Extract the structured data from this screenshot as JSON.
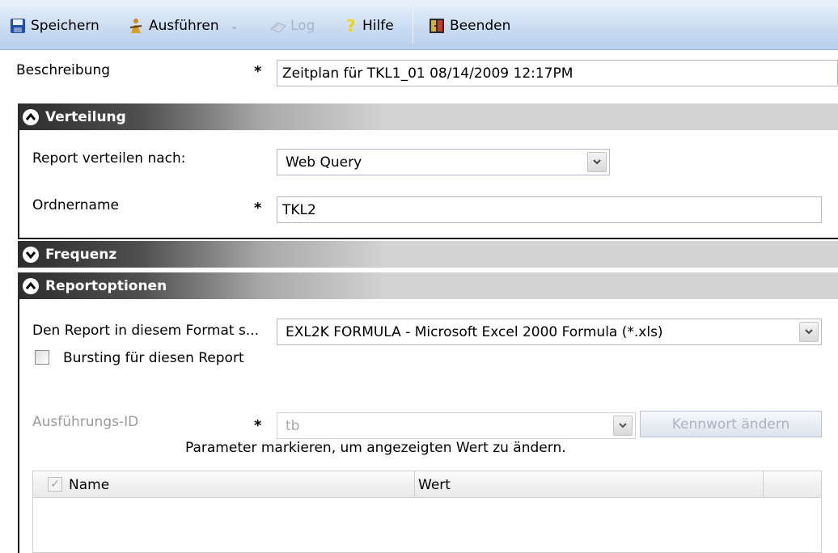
{
  "toolbar": {
    "save": "Speichern",
    "run": "Ausführen",
    "log": "Log",
    "help": "Hilfe",
    "exit": "Beenden"
  },
  "description": {
    "label": "Beschreibung",
    "required_marker": "*",
    "value": "Zeitplan für TKL1_01 08/14/2009 12:17PM"
  },
  "sections": {
    "distribution": "Verteilung",
    "frequency": "Frequenz",
    "report_options": "Reportoptionen"
  },
  "distribution": {
    "distribute_label": "Report verteilen nach:",
    "distribute_value": "Web Query",
    "folder_label": "Ordnername",
    "folder_required": "*",
    "folder_value": "TKL2"
  },
  "report_options": {
    "format_label": "Den Report in diesem Format s...",
    "format_value": "EXL2K FORMULA - Microsoft Excel 2000 Formula (*.xls)",
    "bursting_label": "Bursting für diesen Report",
    "bursting_checked": false,
    "exec_id_label": "Ausführungs-ID",
    "exec_id_required": "*",
    "exec_id_value": "tb",
    "change_password_button": "Kennwort ändern",
    "params_hint": "Parameter markieren, um angezeigten Wert zu ändern.",
    "grid_columns": [
      "Name",
      "Wert"
    ]
  },
  "colors": {
    "toolbar_top": "#eaf2fc",
    "toolbar_bottom": "#b9cfec",
    "section_dark": "#2d2d2d",
    "section_light": "#d3d3d3"
  }
}
